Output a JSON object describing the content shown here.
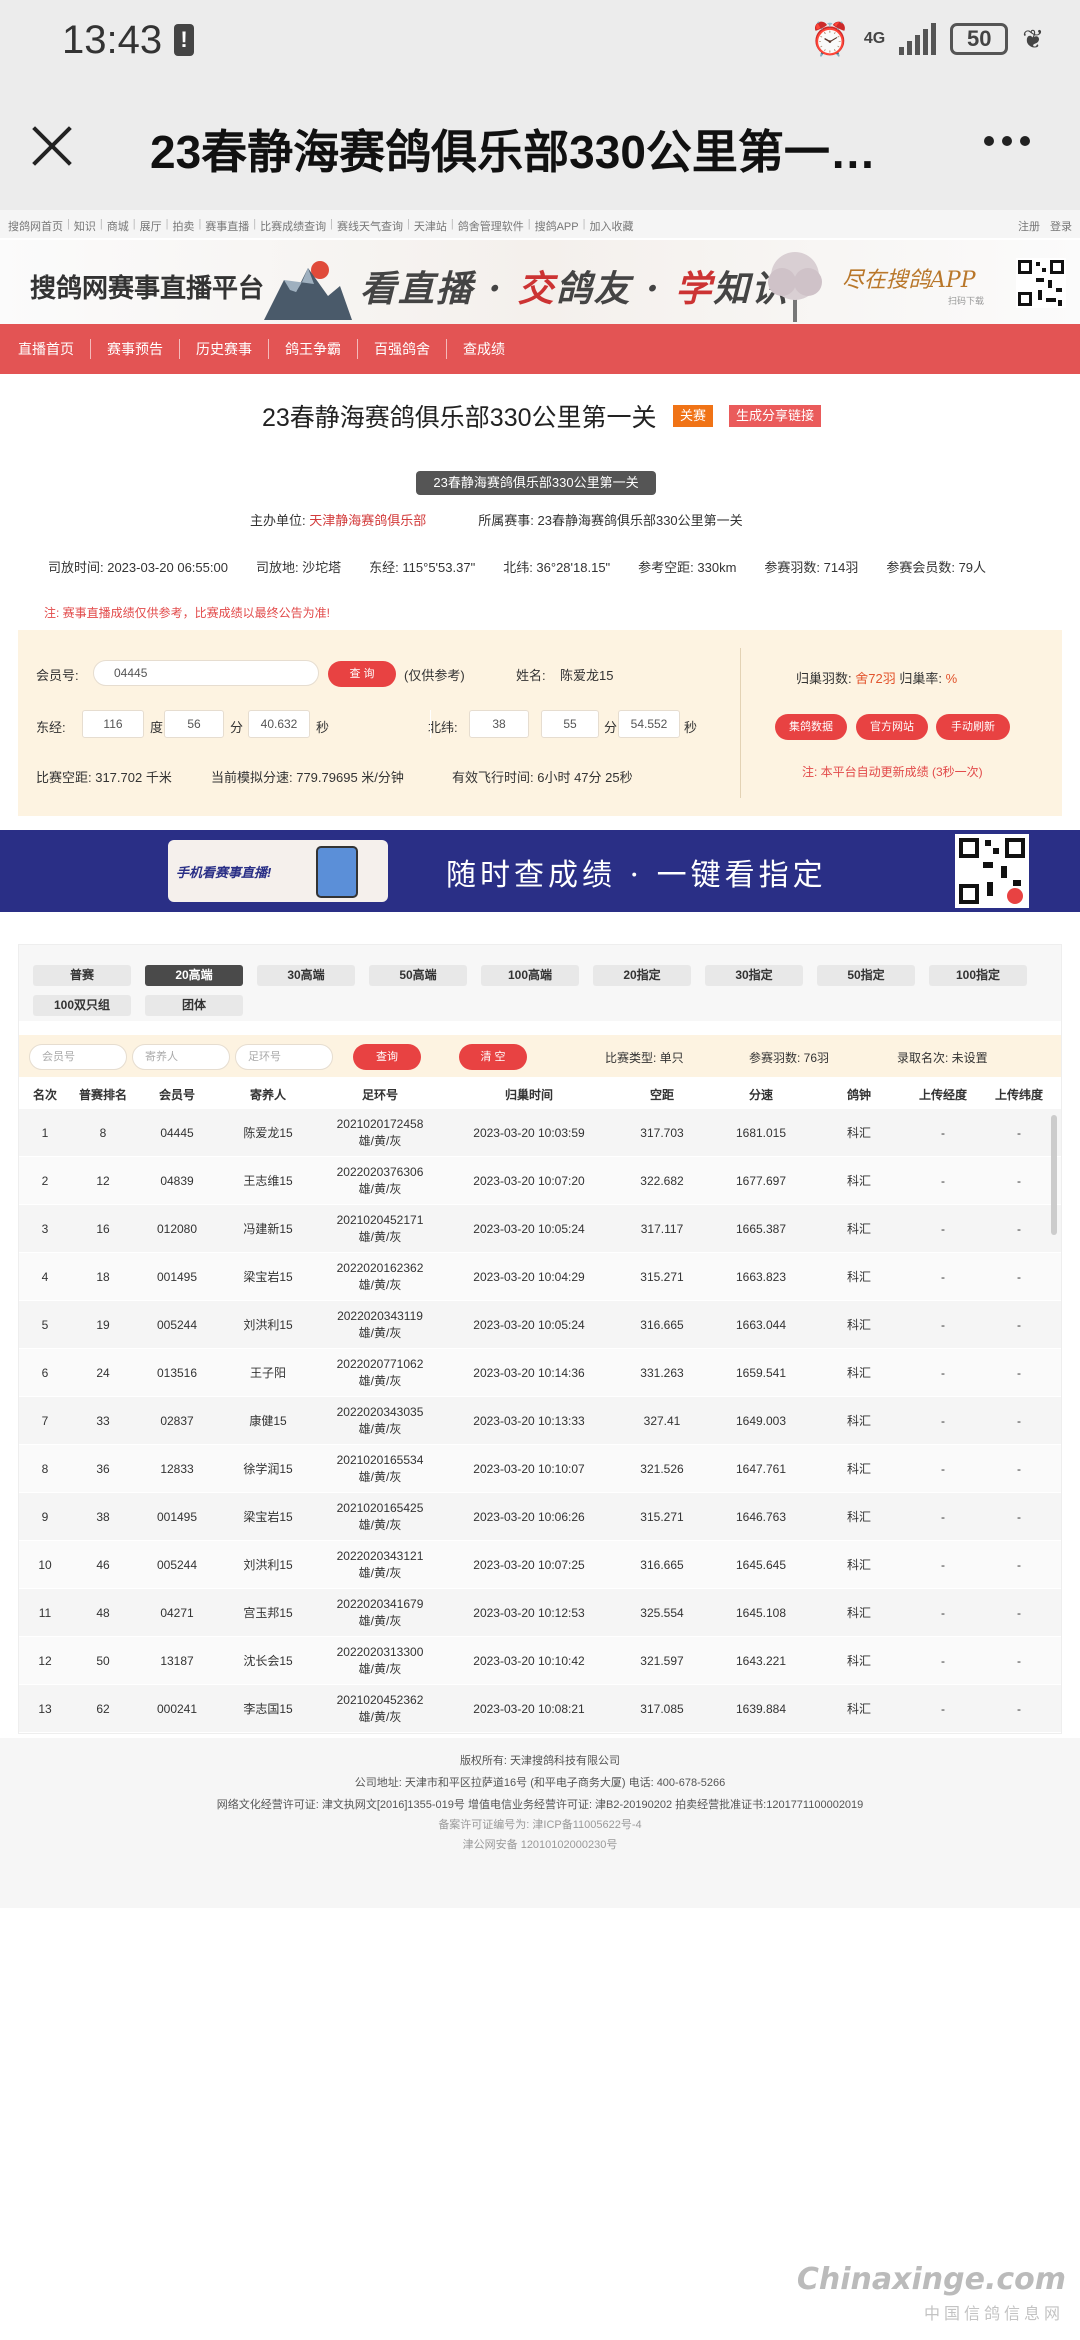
{
  "status": {
    "time": "13:43",
    "network": "4G",
    "battery": "50"
  },
  "browser": {
    "title": "23春静海赛鸽俱乐部330公里第一…"
  },
  "sitenav": {
    "links": [
      "搜鸽网首页",
      "知识",
      "商城",
      "展厅",
      "拍卖",
      "赛事直播",
      "比赛成绩查询",
      "赛线天气查询",
      "天津站",
      "鸽舍管理软件",
      "搜鸽APP",
      "加入收藏"
    ],
    "register": "注册",
    "login": "登录"
  },
  "banner": {
    "logo": "搜鸽网赛事直播平台",
    "slogan_1": "看直播",
    "slogan_2": "交鸽友",
    "slogan_3": "学知识",
    "app": "尽在搜鸽APP",
    "app_sub": "扫码下载"
  },
  "menu": [
    "直播首页",
    "赛事预告",
    "历史赛事",
    "鸽王争霸",
    "百强鸽舍",
    "查成绩"
  ],
  "race": {
    "title": "23春静海赛鸽俱乐部330公里第一关",
    "tag_type": "关赛",
    "tag_share": "生成分享链接",
    "pill": "23春静海赛鸽俱乐部330公里第一关",
    "host_label": "主办单位:",
    "host": "天津静海赛鸽俱乐部",
    "event_label": "所属赛事:",
    "event": "23春静海赛鸽俱乐部330公里第一关",
    "info": [
      "司放时间: 2023-03-20 06:55:00",
      "司放地: 沙坨塔",
      "东经: 115°5'53.37\"",
      "北纬: 36°28'18.15\"",
      "参考空距: 330km",
      "参赛羽数: 714羽",
      "参赛会员数: 79人"
    ],
    "notice": "注: 赛事直播成绩仅供参考，比赛成绩以最终公告为准!"
  },
  "query": {
    "member_label": "会员号:",
    "member_value": "04445",
    "query_btn": "查 询",
    "ref_note": "(仅供参考)",
    "name_label": "姓名:",
    "name_value": "陈爱龙15",
    "east_label": "东经:",
    "east_deg": "116",
    "east_min": "56",
    "east_sec": "40.632",
    "deg_unit": "度",
    "min_unit": "分",
    "sec_unit": "秒",
    "north_label": "北纬:",
    "north_deg": "38",
    "north_min": "55",
    "north_sec": "54.552",
    "distance": "比赛空距: 317.702 千米",
    "speed": "当前模拟分速: 779.79695 米/分钟",
    "flight": "有效飞行时间: 6小时 47分 25秒",
    "home_label": "归巢羽数:",
    "home_value": "舍72羽",
    "rate_label": "归巢率:",
    "rate_value": "%",
    "btn_collect": "集鸽数据",
    "btn_official": "官方网站",
    "btn_refresh": "手动刷新",
    "auto_note": "注: 本平台自动更新成绩 (3秒一次)"
  },
  "ad": {
    "card": "手机看赛事直播!",
    "text": "随时查成绩 · 一键看指定"
  },
  "tabs": {
    "row1": [
      "普赛",
      "20高端",
      "30高端",
      "50高端",
      "100高端",
      "20指定",
      "30指定",
      "50指定",
      "100指定"
    ],
    "row2": [
      "100双只组",
      "团体"
    ],
    "active": "20高端"
  },
  "filter": {
    "member_ph": "会员号",
    "owner_ph": "寄养人",
    "ring_ph": "足环号",
    "query_btn": "查询",
    "clear_btn": "清 空",
    "type": "比赛类型:  单只",
    "count": "参赛羽数:  76羽",
    "prize": "录取名次:  未设置"
  },
  "table": {
    "headers": [
      "名次",
      "普赛排名",
      "会员号",
      "寄养人",
      "足环号",
      "归巢时间",
      "空距",
      "分速",
      "鸽钟",
      "上传经度",
      "上传纬度"
    ],
    "rows": [
      [
        "1",
        "8",
        "04445",
        "陈爱龙15",
        "2021020172458",
        "雄/黄/灰",
        "2023-03-20 10:03:59",
        "317.703",
        "1681.015",
        "科汇",
        "-",
        "-"
      ],
      [
        "2",
        "12",
        "04839",
        "王志维15",
        "2022020376306",
        "雄/黄/灰",
        "2023-03-20 10:07:20",
        "322.682",
        "1677.697",
        "科汇",
        "-",
        "-"
      ],
      [
        "3",
        "16",
        "012080",
        "冯建新15",
        "2021020452171",
        "雄/黄/灰",
        "2023-03-20 10:05:24",
        "317.117",
        "1665.387",
        "科汇",
        "-",
        "-"
      ],
      [
        "4",
        "18",
        "001495",
        "梁宝岩15",
        "2022020162362",
        "雄/黄/灰",
        "2023-03-20 10:04:29",
        "315.271",
        "1663.823",
        "科汇",
        "-",
        "-"
      ],
      [
        "5",
        "19",
        "005244",
        "刘洪利15",
        "2022020343119",
        "雄/黄/灰",
        "2023-03-20 10:05:24",
        "316.665",
        "1663.044",
        "科汇",
        "-",
        "-"
      ],
      [
        "6",
        "24",
        "013516",
        "王子阳",
        "2022020771062",
        "雄/黄/灰",
        "2023-03-20 10:14:36",
        "331.263",
        "1659.541",
        "科汇",
        "-",
        "-"
      ],
      [
        "7",
        "33",
        "02837",
        "康健15",
        "2022020343035",
        "雄/黄/灰",
        "2023-03-20 10:13:33",
        "327.41",
        "1649.003",
        "科汇",
        "-",
        "-"
      ],
      [
        "8",
        "36",
        "12833",
        "徐学润15",
        "2021020165534",
        "雄/黄/灰",
        "2023-03-20 10:10:07",
        "321.526",
        "1647.761",
        "科汇",
        "-",
        "-"
      ],
      [
        "9",
        "38",
        "001495",
        "梁宝岩15",
        "2021020165425",
        "雄/黄/灰",
        "2023-03-20 10:06:26",
        "315.271",
        "1646.763",
        "科汇",
        "-",
        "-"
      ],
      [
        "10",
        "46",
        "005244",
        "刘洪利15",
        "2022020343121",
        "雄/黄/灰",
        "2023-03-20 10:07:25",
        "316.665",
        "1645.645",
        "科汇",
        "-",
        "-"
      ],
      [
        "11",
        "48",
        "04271",
        "宫玉邦15",
        "2022020341679",
        "雄/黄/灰",
        "2023-03-20 10:12:53",
        "325.554",
        "1645.108",
        "科汇",
        "-",
        "-"
      ],
      [
        "12",
        "50",
        "13187",
        "沈长会15",
        "2022020313300",
        "雄/黄/灰",
        "2023-03-20 10:10:42",
        "321.597",
        "1643.221",
        "科汇",
        "-",
        "-"
      ],
      [
        "13",
        "62",
        "000241",
        "李志国15",
        "2021020452362",
        "雄/黄/灰",
        "2023-03-20 10:08:21",
        "317.085",
        "1639.884",
        "科汇",
        "-",
        "-"
      ]
    ]
  },
  "footer": {
    "line1": "版权所有: 天津搜鸽科技有限公司",
    "line2": "公司地址:  天津市和平区拉萨道16号 (和平电子商务大厦)  电话:  400-678-5266",
    "line3": "网络文化经营许可证:  津文执网文[2016]1355-019号     增值电信业务经营许可证:  津B2-20190202     拍卖经营批准证书:1201771100002019",
    "line4": "备案许可证编号为:  津ICP备11005622号-4",
    "line5": "津公网安备 12010102000230号"
  },
  "watermark": {
    "main": "Chinaxinge.com",
    "sub": "中国信鸽信息网"
  }
}
